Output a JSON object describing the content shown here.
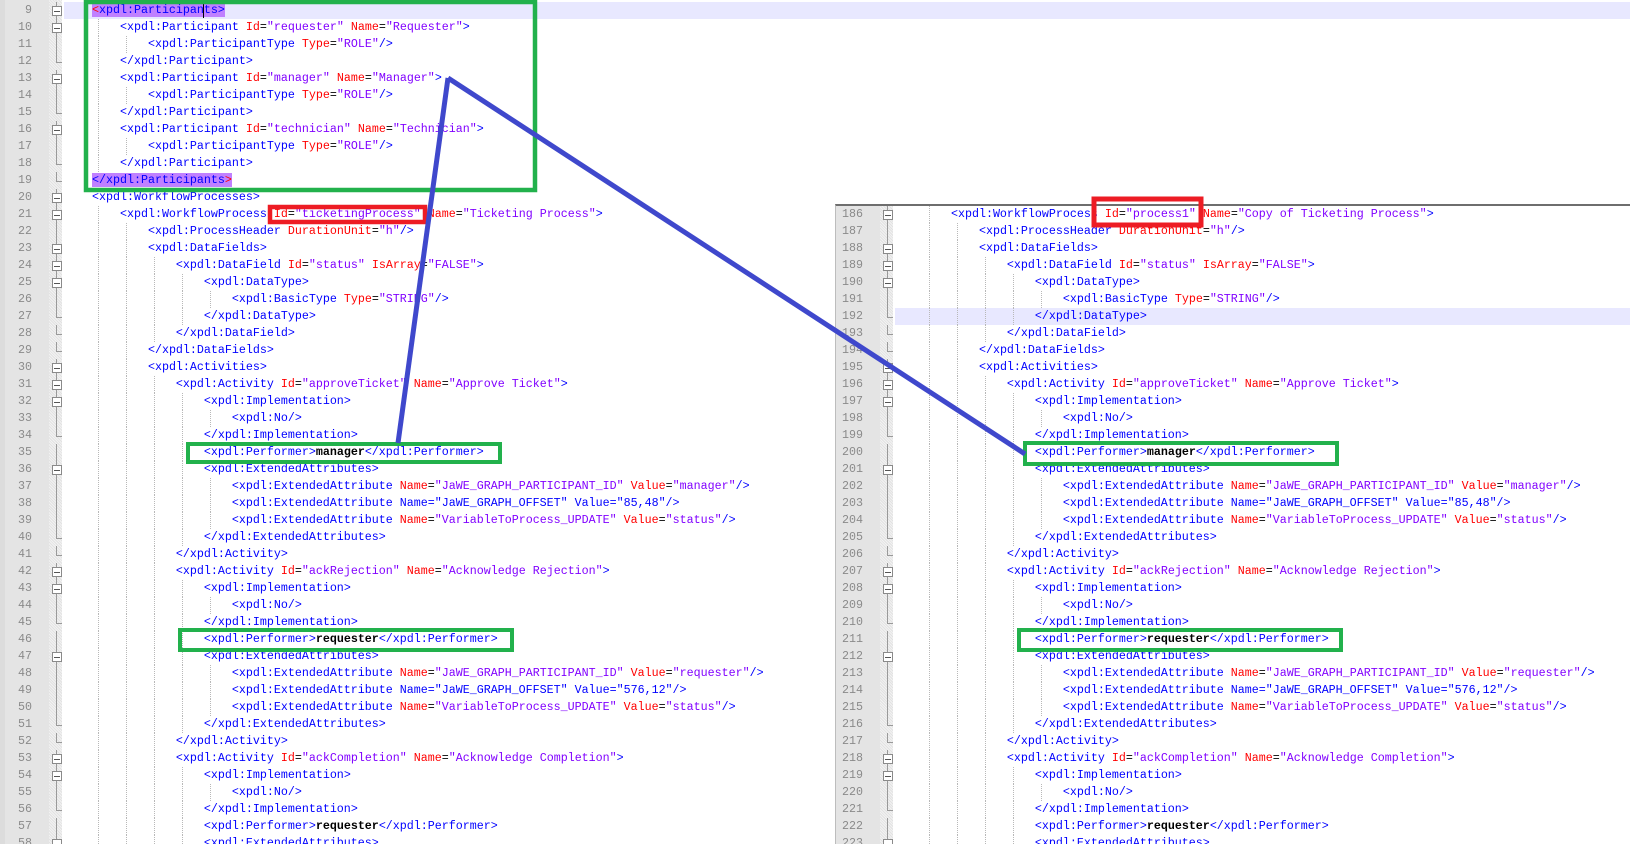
{
  "annotation_colors": {
    "green_box": "#22b14c",
    "red_box": "#ed1c24",
    "connector_line": "#3f48cc"
  },
  "syntax_colors": {
    "tag": "#0000ff",
    "attribute": "#ff0000",
    "value": "#8000ff",
    "text": "#000000",
    "current_line": "#e8e8ff",
    "brace_match": "#c080ff"
  },
  "left_editor": {
    "current_line": 9,
    "lines": [
      {
        "n": 9,
        "text": "    <xpdl:Participants>",
        "brace_match": "open"
      },
      {
        "n": 10,
        "text": "        <xpdl:Participant Id=\"requester\" Name=\"Requester\">"
      },
      {
        "n": 11,
        "text": "            <xpdl:ParticipantType Type=\"ROLE\"/>"
      },
      {
        "n": 12,
        "text": "        </xpdl:Participant>"
      },
      {
        "n": 13,
        "text": "        <xpdl:Participant Id=\"manager\" Name=\"Manager\">"
      },
      {
        "n": 14,
        "text": "            <xpdl:ParticipantType Type=\"ROLE\"/>"
      },
      {
        "n": 15,
        "text": "        </xpdl:Participant>"
      },
      {
        "n": 16,
        "text": "        <xpdl:Participant Id=\"technician\" Name=\"Technician\">"
      },
      {
        "n": 17,
        "text": "            <xpdl:ParticipantType Type=\"ROLE\"/>"
      },
      {
        "n": 18,
        "text": "        </xpdl:Participant>"
      },
      {
        "n": 19,
        "text": "    </xpdl:Participants>",
        "brace_match": "close"
      },
      {
        "n": 20,
        "text": "    <xpdl:WorkflowProcesses>"
      },
      {
        "n": 21,
        "text": "        <xpdl:WorkflowProcess Id=\"ticketingProcess\" Name=\"Ticketing Process\">"
      },
      {
        "n": 22,
        "text": "            <xpdl:ProcessHeader DurationUnit=\"h\"/>"
      },
      {
        "n": 23,
        "text": "            <xpdl:DataFields>"
      },
      {
        "n": 24,
        "text": "                <xpdl:DataField Id=\"status\" IsArray=\"FALSE\">"
      },
      {
        "n": 25,
        "text": "                    <xpdl:DataType>"
      },
      {
        "n": 26,
        "text": "                        <xpdl:BasicType Type=\"STRING\"/>"
      },
      {
        "n": 27,
        "text": "                    </xpdl:DataType>"
      },
      {
        "n": 28,
        "text": "                </xpdl:DataField>"
      },
      {
        "n": 29,
        "text": "            </xpdl:DataFields>"
      },
      {
        "n": 30,
        "text": "            <xpdl:Activities>"
      },
      {
        "n": 31,
        "text": "                <xpdl:Activity Id=\"approveTicket\" Name=\"Approve Ticket\">"
      },
      {
        "n": 32,
        "text": "                    <xpdl:Implementation>"
      },
      {
        "n": 33,
        "text": "                        <xpdl:No/>"
      },
      {
        "n": 34,
        "text": "                    </xpdl:Implementation>"
      },
      {
        "n": 35,
        "text": "                    <xpdl:Performer>manager</xpdl:Performer>"
      },
      {
        "n": 36,
        "text": "                    <xpdl:ExtendedAttributes>"
      },
      {
        "n": 37,
        "text": "                        <xpdl:ExtendedAttribute Name=\"JaWE_GRAPH_PARTICIPANT_ID\" Value=\"manager\"/>"
      },
      {
        "n": 38,
        "text": "                        <xpdl:ExtendedAttribute Name=\"JaWE_GRAPH_OFFSET\" Value=\"85,48\"/>"
      },
      {
        "n": 39,
        "text": "                        <xpdl:ExtendedAttribute Name=\"VariableToProcess_UPDATE\" Value=\"status\"/>"
      },
      {
        "n": 40,
        "text": "                    </xpdl:ExtendedAttributes>"
      },
      {
        "n": 41,
        "text": "                </xpdl:Activity>"
      },
      {
        "n": 42,
        "text": "                <xpdl:Activity Id=\"ackRejection\" Name=\"Acknowledge Rejection\">"
      },
      {
        "n": 43,
        "text": "                    <xpdl:Implementation>"
      },
      {
        "n": 44,
        "text": "                        <xpdl:No/>"
      },
      {
        "n": 45,
        "text": "                    </xpdl:Implementation>"
      },
      {
        "n": 46,
        "text": "                    <xpdl:Performer>requester</xpdl:Performer>"
      },
      {
        "n": 47,
        "text": "                    <xpdl:ExtendedAttributes>"
      },
      {
        "n": 48,
        "text": "                        <xpdl:ExtendedAttribute Name=\"JaWE_GRAPH_PARTICIPANT_ID\" Value=\"requester\"/>"
      },
      {
        "n": 49,
        "text": "                        <xpdl:ExtendedAttribute Name=\"JaWE_GRAPH_OFFSET\" Value=\"576,12\"/>"
      },
      {
        "n": 50,
        "text": "                        <xpdl:ExtendedAttribute Name=\"VariableToProcess_UPDATE\" Value=\"status\"/>"
      },
      {
        "n": 51,
        "text": "                    </xpdl:ExtendedAttributes>"
      },
      {
        "n": 52,
        "text": "                </xpdl:Activity>"
      },
      {
        "n": 53,
        "text": "                <xpdl:Activity Id=\"ackCompletion\" Name=\"Acknowledge Completion\">"
      },
      {
        "n": 54,
        "text": "                    <xpdl:Implementation>"
      },
      {
        "n": 55,
        "text": "                        <xpdl:No/>"
      },
      {
        "n": 56,
        "text": "                    </xpdl:Implementation>"
      },
      {
        "n": 57,
        "text": "                    <xpdl:Performer>requester</xpdl:Performer>"
      },
      {
        "n": 58,
        "text": "                    <xpdl:ExtendedAttributes>"
      }
    ]
  },
  "right_editor": {
    "current_line": 192,
    "lines": [
      {
        "n": 186,
        "text": "        <xpdl:WorkflowProcess Id=\"process1\" Name=\"Copy of Ticketing Process\">"
      },
      {
        "n": 187,
        "text": "            <xpdl:ProcessHeader DurationUnit=\"h\"/>"
      },
      {
        "n": 188,
        "text": "            <xpdl:DataFields>"
      },
      {
        "n": 189,
        "text": "                <xpdl:DataField Id=\"status\" IsArray=\"FALSE\">"
      },
      {
        "n": 190,
        "text": "                    <xpdl:DataType>"
      },
      {
        "n": 191,
        "text": "                        <xpdl:BasicType Type=\"STRING\"/>"
      },
      {
        "n": 192,
        "text": "                    </xpdl:DataType>"
      },
      {
        "n": 193,
        "text": "                </xpdl:DataField>"
      },
      {
        "n": 194,
        "text": "            </xpdl:DataFields>"
      },
      {
        "n": 195,
        "text": "            <xpdl:Activities>"
      },
      {
        "n": 196,
        "text": "                <xpdl:Activity Id=\"approveTicket\" Name=\"Approve Ticket\">"
      },
      {
        "n": 197,
        "text": "                    <xpdl:Implementation>"
      },
      {
        "n": 198,
        "text": "                        <xpdl:No/>"
      },
      {
        "n": 199,
        "text": "                    </xpdl:Implementation>"
      },
      {
        "n": 200,
        "text": "                    <xpdl:Performer>manager</xpdl:Performer>"
      },
      {
        "n": 201,
        "text": "                    <xpdl:ExtendedAttributes>"
      },
      {
        "n": 202,
        "text": "                        <xpdl:ExtendedAttribute Name=\"JaWE_GRAPH_PARTICIPANT_ID\" Value=\"manager\"/>"
      },
      {
        "n": 203,
        "text": "                        <xpdl:ExtendedAttribute Name=\"JaWE_GRAPH_OFFSET\" Value=\"85,48\"/>"
      },
      {
        "n": 204,
        "text": "                        <xpdl:ExtendedAttribute Name=\"VariableToProcess_UPDATE\" Value=\"status\"/>"
      },
      {
        "n": 205,
        "text": "                    </xpdl:ExtendedAttributes>"
      },
      {
        "n": 206,
        "text": "                </xpdl:Activity>"
      },
      {
        "n": 207,
        "text": "                <xpdl:Activity Id=\"ackRejection\" Name=\"Acknowledge Rejection\">"
      },
      {
        "n": 208,
        "text": "                    <xpdl:Implementation>"
      },
      {
        "n": 209,
        "text": "                        <xpdl:No/>"
      },
      {
        "n": 210,
        "text": "                    </xpdl:Implementation>"
      },
      {
        "n": 211,
        "text": "                    <xpdl:Performer>requester</xpdl:Performer>"
      },
      {
        "n": 212,
        "text": "                    <xpdl:ExtendedAttributes>"
      },
      {
        "n": 213,
        "text": "                        <xpdl:ExtendedAttribute Name=\"JaWE_GRAPH_PARTICIPANT_ID\" Value=\"requester\"/>"
      },
      {
        "n": 214,
        "text": "                        <xpdl:ExtendedAttribute Name=\"JaWE_GRAPH_OFFSET\" Value=\"576,12\"/>"
      },
      {
        "n": 215,
        "text": "                        <xpdl:ExtendedAttribute Name=\"VariableToProcess_UPDATE\" Value=\"status\"/>"
      },
      {
        "n": 216,
        "text": "                    </xpdl:ExtendedAttributes>"
      },
      {
        "n": 217,
        "text": "                </xpdl:Activity>"
      },
      {
        "n": 218,
        "text": "                <xpdl:Activity Id=\"ackCompletion\" Name=\"Acknowledge Completion\">"
      },
      {
        "n": 219,
        "text": "                    <xpdl:Implementation>"
      },
      {
        "n": 220,
        "text": "                        <xpdl:No/>"
      },
      {
        "n": 221,
        "text": "                    </xpdl:Implementation>"
      },
      {
        "n": 222,
        "text": "                    <xpdl:Performer>requester</xpdl:Performer>"
      },
      {
        "n": 223,
        "text": "                    <xpdl:ExtendedAttributes>"
      }
    ]
  }
}
